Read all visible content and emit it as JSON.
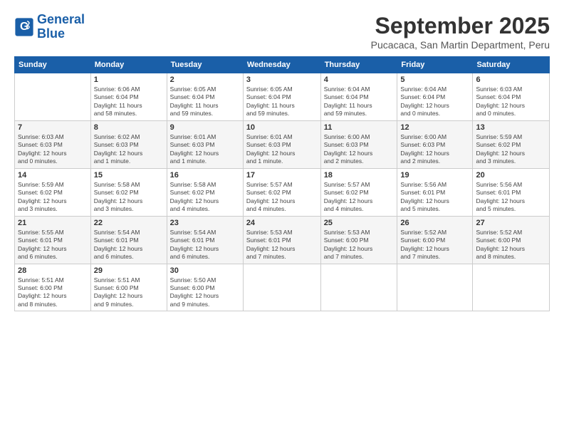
{
  "logo": {
    "line1": "General",
    "line2": "Blue"
  },
  "title": "September 2025",
  "subtitle": "Pucacaca, San Martin Department, Peru",
  "days_of_week": [
    "Sunday",
    "Monday",
    "Tuesday",
    "Wednesday",
    "Thursday",
    "Friday",
    "Saturday"
  ],
  "weeks": [
    [
      {
        "day": "",
        "info": ""
      },
      {
        "day": "1",
        "info": "Sunrise: 6:06 AM\nSunset: 6:04 PM\nDaylight: 11 hours\nand 58 minutes."
      },
      {
        "day": "2",
        "info": "Sunrise: 6:05 AM\nSunset: 6:04 PM\nDaylight: 11 hours\nand 59 minutes."
      },
      {
        "day": "3",
        "info": "Sunrise: 6:05 AM\nSunset: 6:04 PM\nDaylight: 11 hours\nand 59 minutes."
      },
      {
        "day": "4",
        "info": "Sunrise: 6:04 AM\nSunset: 6:04 PM\nDaylight: 11 hours\nand 59 minutes."
      },
      {
        "day": "5",
        "info": "Sunrise: 6:04 AM\nSunset: 6:04 PM\nDaylight: 12 hours\nand 0 minutes."
      },
      {
        "day": "6",
        "info": "Sunrise: 6:03 AM\nSunset: 6:04 PM\nDaylight: 12 hours\nand 0 minutes."
      }
    ],
    [
      {
        "day": "7",
        "info": "Sunrise: 6:03 AM\nSunset: 6:03 PM\nDaylight: 12 hours\nand 0 minutes."
      },
      {
        "day": "8",
        "info": "Sunrise: 6:02 AM\nSunset: 6:03 PM\nDaylight: 12 hours\nand 1 minute."
      },
      {
        "day": "9",
        "info": "Sunrise: 6:01 AM\nSunset: 6:03 PM\nDaylight: 12 hours\nand 1 minute."
      },
      {
        "day": "10",
        "info": "Sunrise: 6:01 AM\nSunset: 6:03 PM\nDaylight: 12 hours\nand 1 minute."
      },
      {
        "day": "11",
        "info": "Sunrise: 6:00 AM\nSunset: 6:03 PM\nDaylight: 12 hours\nand 2 minutes."
      },
      {
        "day": "12",
        "info": "Sunrise: 6:00 AM\nSunset: 6:03 PM\nDaylight: 12 hours\nand 2 minutes."
      },
      {
        "day": "13",
        "info": "Sunrise: 5:59 AM\nSunset: 6:02 PM\nDaylight: 12 hours\nand 3 minutes."
      }
    ],
    [
      {
        "day": "14",
        "info": "Sunrise: 5:59 AM\nSunset: 6:02 PM\nDaylight: 12 hours\nand 3 minutes."
      },
      {
        "day": "15",
        "info": "Sunrise: 5:58 AM\nSunset: 6:02 PM\nDaylight: 12 hours\nand 3 minutes."
      },
      {
        "day": "16",
        "info": "Sunrise: 5:58 AM\nSunset: 6:02 PM\nDaylight: 12 hours\nand 4 minutes."
      },
      {
        "day": "17",
        "info": "Sunrise: 5:57 AM\nSunset: 6:02 PM\nDaylight: 12 hours\nand 4 minutes."
      },
      {
        "day": "18",
        "info": "Sunrise: 5:57 AM\nSunset: 6:02 PM\nDaylight: 12 hours\nand 4 minutes."
      },
      {
        "day": "19",
        "info": "Sunrise: 5:56 AM\nSunset: 6:01 PM\nDaylight: 12 hours\nand 5 minutes."
      },
      {
        "day": "20",
        "info": "Sunrise: 5:56 AM\nSunset: 6:01 PM\nDaylight: 12 hours\nand 5 minutes."
      }
    ],
    [
      {
        "day": "21",
        "info": "Sunrise: 5:55 AM\nSunset: 6:01 PM\nDaylight: 12 hours\nand 6 minutes."
      },
      {
        "day": "22",
        "info": "Sunrise: 5:54 AM\nSunset: 6:01 PM\nDaylight: 12 hours\nand 6 minutes."
      },
      {
        "day": "23",
        "info": "Sunrise: 5:54 AM\nSunset: 6:01 PM\nDaylight: 12 hours\nand 6 minutes."
      },
      {
        "day": "24",
        "info": "Sunrise: 5:53 AM\nSunset: 6:01 PM\nDaylight: 12 hours\nand 7 minutes."
      },
      {
        "day": "25",
        "info": "Sunrise: 5:53 AM\nSunset: 6:00 PM\nDaylight: 12 hours\nand 7 minutes."
      },
      {
        "day": "26",
        "info": "Sunrise: 5:52 AM\nSunset: 6:00 PM\nDaylight: 12 hours\nand 7 minutes."
      },
      {
        "day": "27",
        "info": "Sunrise: 5:52 AM\nSunset: 6:00 PM\nDaylight: 12 hours\nand 8 minutes."
      }
    ],
    [
      {
        "day": "28",
        "info": "Sunrise: 5:51 AM\nSunset: 6:00 PM\nDaylight: 12 hours\nand 8 minutes."
      },
      {
        "day": "29",
        "info": "Sunrise: 5:51 AM\nSunset: 6:00 PM\nDaylight: 12 hours\nand 9 minutes."
      },
      {
        "day": "30",
        "info": "Sunrise: 5:50 AM\nSunset: 6:00 PM\nDaylight: 12 hours\nand 9 minutes."
      },
      {
        "day": "",
        "info": ""
      },
      {
        "day": "",
        "info": ""
      },
      {
        "day": "",
        "info": ""
      },
      {
        "day": "",
        "info": ""
      }
    ]
  ]
}
